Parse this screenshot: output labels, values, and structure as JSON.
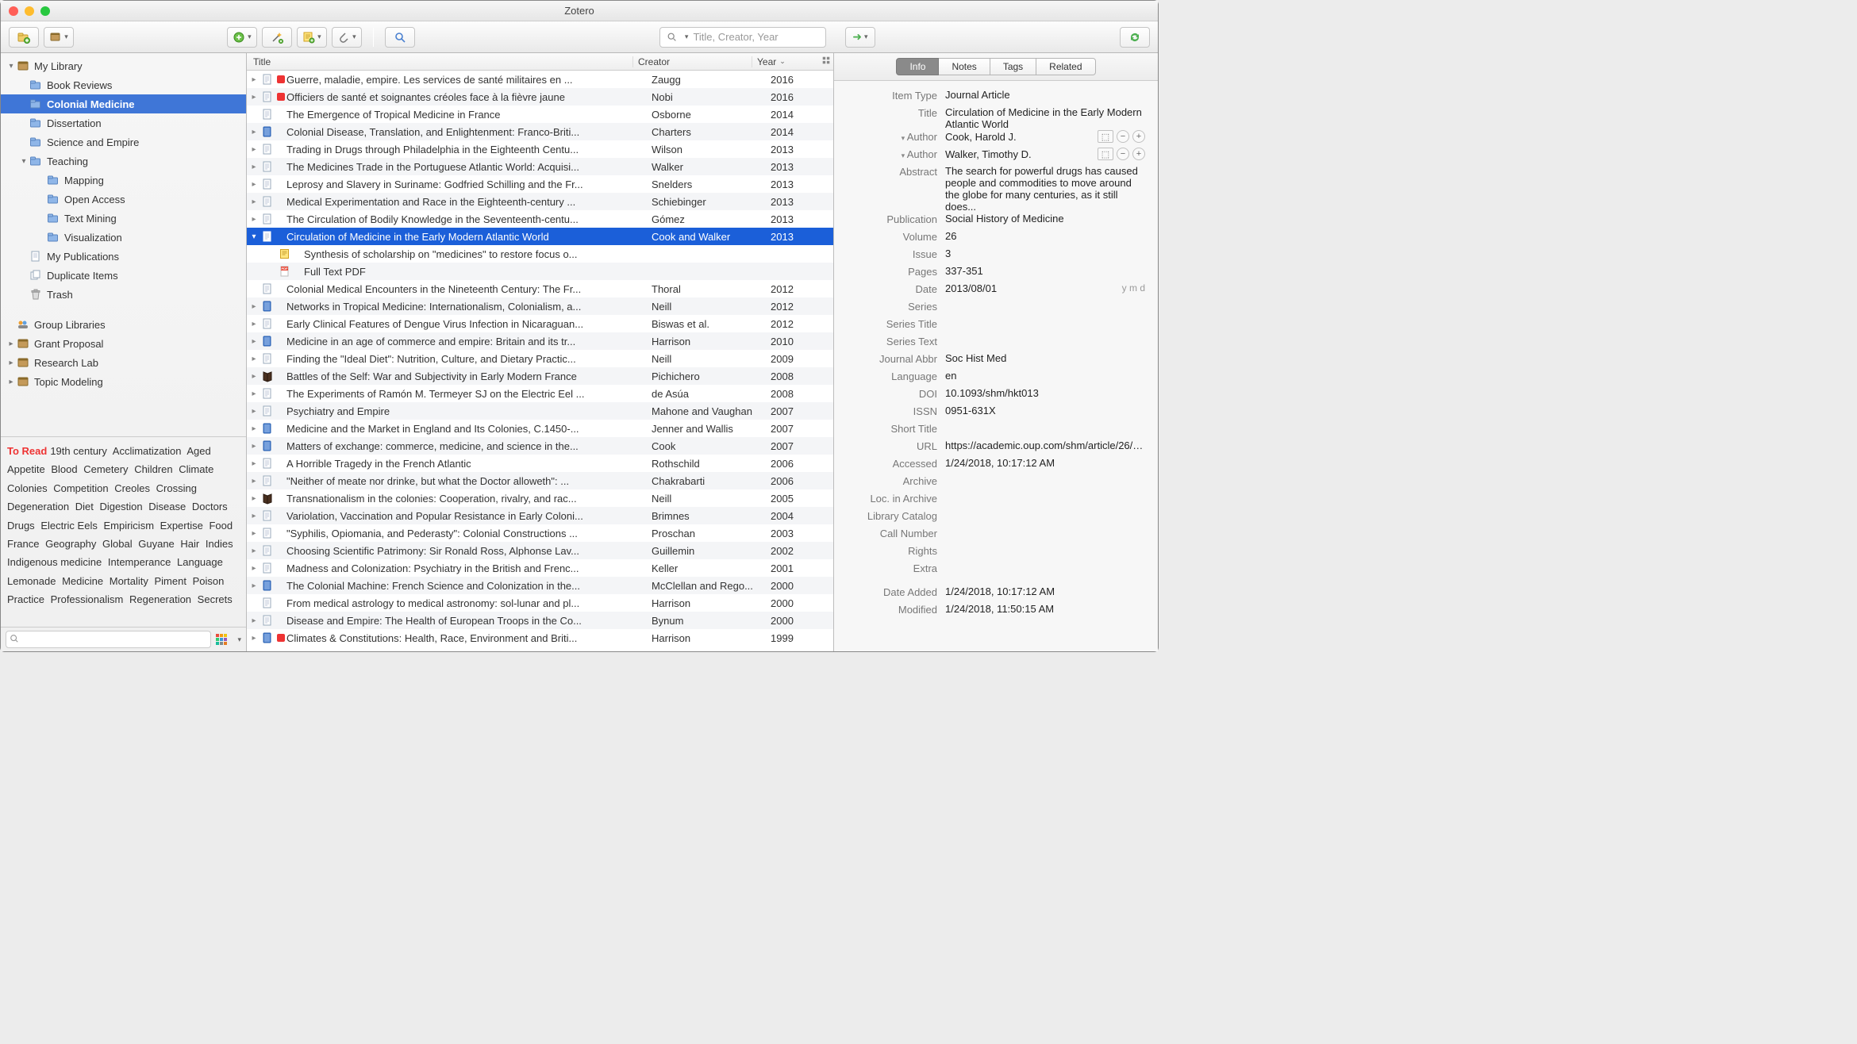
{
  "app": {
    "title": "Zotero"
  },
  "toolbar": {
    "search_placeholder": "Title, Creator, Year"
  },
  "sidebar": {
    "library_label": "My Library",
    "library_items": [
      {
        "label": "Book Reviews",
        "selected": false,
        "disc": "",
        "icon": "folder"
      },
      {
        "label": "Colonial Medicine",
        "selected": true,
        "disc": "",
        "icon": "folder"
      },
      {
        "label": "Dissertation",
        "selected": false,
        "disc": "",
        "icon": "folder"
      },
      {
        "label": "Science and Empire",
        "selected": false,
        "disc": "",
        "icon": "folder"
      },
      {
        "label": "Teaching",
        "selected": false,
        "disc": "down",
        "icon": "folder"
      }
    ],
    "teaching_children": [
      {
        "label": "Mapping"
      },
      {
        "label": "Open Access"
      },
      {
        "label": "Text Mining"
      },
      {
        "label": "Visualization"
      }
    ],
    "special": [
      {
        "label": "My Publications",
        "icon": "pub"
      },
      {
        "label": "Duplicate Items",
        "icon": "dup"
      },
      {
        "label": "Trash",
        "icon": "trash"
      }
    ],
    "group_label": "Group Libraries",
    "groups": [
      {
        "label": "Grant Proposal"
      },
      {
        "label": "Research Lab"
      },
      {
        "label": "Topic Modeling"
      }
    ]
  },
  "tags": {
    "highlight": "To Read",
    "list": [
      "19th century",
      "Acclimatization",
      "Aged",
      "Appetite",
      "Blood",
      "Cemetery",
      "Children",
      "Climate",
      "Colonies",
      "Competition",
      "Creoles",
      "Crossing",
      "Degeneration",
      "Diet",
      "Digestion",
      "Disease",
      "Doctors",
      "Drugs",
      "Electric Eels",
      "Empiricism",
      "Expertise",
      "Food",
      "France",
      "Geography",
      "Global",
      "Guyane",
      "Hair",
      "Indies",
      "Indigenous medicine",
      "Intemperance",
      "Language",
      "Lemonade",
      "Medicine",
      "Mortality",
      "Piment",
      "Poison",
      "Practice",
      "Professionalism",
      "Regeneration",
      "Secrets"
    ]
  },
  "columns": {
    "title": "Title",
    "creator": "Creator",
    "year": "Year"
  },
  "items": [
    {
      "disc": "right",
      "icon": "doc",
      "tag": "#e33",
      "title": "Guerre, maladie, empire. Les services de santé militaires en ...",
      "creator": "Zaugg",
      "year": "2016"
    },
    {
      "disc": "right",
      "icon": "doc",
      "tag": "#e33",
      "title": "Officiers de santé et soignantes créoles face à la fièvre jaune",
      "creator": "Nobi",
      "year": "2016"
    },
    {
      "disc": "",
      "icon": "doc",
      "tag": "",
      "title": "The Emergence of Tropical Medicine in France",
      "creator": "Osborne",
      "year": "2014"
    },
    {
      "disc": "right",
      "icon": "book",
      "tag": "",
      "title": "Colonial Disease, Translation, and Enlightenment: Franco-Briti...",
      "creator": "Charters",
      "year": "2014"
    },
    {
      "disc": "right",
      "icon": "doc",
      "tag": "",
      "title": "Trading in Drugs through Philadelphia in the Eighteenth Centu...",
      "creator": "Wilson",
      "year": "2013"
    },
    {
      "disc": "right",
      "icon": "doc",
      "tag": "",
      "title": "The Medicines Trade in the Portuguese Atlantic World: Acquisi...",
      "creator": "Walker",
      "year": "2013"
    },
    {
      "disc": "right",
      "icon": "doc",
      "tag": "",
      "title": "Leprosy and Slavery in Suriname: Godfried Schilling and the Fr...",
      "creator": "Snelders",
      "year": "2013"
    },
    {
      "disc": "right",
      "icon": "doc",
      "tag": "",
      "title": "Medical Experimentation and Race in the Eighteenth-century ...",
      "creator": "Schiebinger",
      "year": "2013"
    },
    {
      "disc": "right",
      "icon": "doc",
      "tag": "",
      "title": "The Circulation of Bodily Knowledge in the Seventeenth-centu...",
      "creator": "Gómez",
      "year": "2013"
    },
    {
      "disc": "down",
      "icon": "doc",
      "tag": "",
      "title": "Circulation of Medicine in the Early Modern Atlantic World",
      "creator": "Cook and Walker",
      "year": "2013",
      "selected": true
    },
    {
      "disc": "",
      "child": true,
      "icon": "note",
      "tag": "",
      "title": "Synthesis of scholarship on \"medicines\" to restore focus o...",
      "creator": "",
      "year": ""
    },
    {
      "disc": "",
      "child": true,
      "icon": "pdf",
      "tag": "",
      "title": "Full Text PDF",
      "creator": "",
      "year": ""
    },
    {
      "disc": "",
      "icon": "doc",
      "tag": "",
      "title": "Colonial Medical Encounters in the Nineteenth Century: The Fr...",
      "creator": "Thoral",
      "year": "2012"
    },
    {
      "disc": "right",
      "icon": "book",
      "tag": "",
      "title": "Networks in Tropical Medicine: Internationalism, Colonialism, a...",
      "creator": "Neill",
      "year": "2012"
    },
    {
      "disc": "right",
      "icon": "doc",
      "tag": "",
      "title": "Early Clinical Features of Dengue Virus Infection in Nicaraguan...",
      "creator": "Biswas et al.",
      "year": "2012"
    },
    {
      "disc": "right",
      "icon": "book",
      "tag": "",
      "title": "Medicine in an age of commerce and empire: Britain and its tr...",
      "creator": "Harrison",
      "year": "2010"
    },
    {
      "disc": "right",
      "icon": "doc",
      "tag": "",
      "title": "Finding the \"Ideal Diet\": Nutrition, Culture, and Dietary Practic...",
      "creator": "Neill",
      "year": "2009"
    },
    {
      "disc": "right",
      "icon": "bookalt",
      "tag": "",
      "title": "Battles of the Self: War and Subjectivity in Early Modern France",
      "creator": "Pichichero",
      "year": "2008"
    },
    {
      "disc": "right",
      "icon": "doc",
      "tag": "",
      "title": "The Experiments of Ramón M. Termeyer SJ on the Electric Eel ...",
      "creator": "de Asúa",
      "year": "2008"
    },
    {
      "disc": "right",
      "icon": "doc",
      "tag": "",
      "title": "Psychiatry and Empire",
      "creator": "Mahone and Vaughan",
      "year": "2007"
    },
    {
      "disc": "right",
      "icon": "book",
      "tag": "",
      "title": "Medicine and the Market in England and Its Colonies, C.1450-...",
      "creator": "Jenner and Wallis",
      "year": "2007"
    },
    {
      "disc": "right",
      "icon": "book",
      "tag": "",
      "title": "Matters of exchange: commerce, medicine, and science in the...",
      "creator": "Cook",
      "year": "2007"
    },
    {
      "disc": "right",
      "icon": "doc",
      "tag": "",
      "title": "A Horrible Tragedy in the French Atlantic",
      "creator": "Rothschild",
      "year": "2006"
    },
    {
      "disc": "right",
      "icon": "doc",
      "tag": "",
      "title": "\"Neither of meate nor drinke, but what the Doctor alloweth\": ...",
      "creator": "Chakrabarti",
      "year": "2006"
    },
    {
      "disc": "right",
      "icon": "bookalt",
      "tag": "",
      "title": "Transnationalism in the colonies: Cooperation, rivalry, and rac...",
      "creator": "Neill",
      "year": "2005"
    },
    {
      "disc": "right",
      "icon": "doc",
      "tag": "",
      "title": "Variolation, Vaccination and Popular Resistance in Early Coloni...",
      "creator": "Brimnes",
      "year": "2004"
    },
    {
      "disc": "right",
      "icon": "doc",
      "tag": "",
      "title": "\"Syphilis, Opiomania, and Pederasty\": Colonial Constructions ...",
      "creator": "Proschan",
      "year": "2003"
    },
    {
      "disc": "right",
      "icon": "doc",
      "tag": "",
      "title": "Choosing Scientific Patrimony: Sir Ronald Ross, Alphonse Lav...",
      "creator": "Guillemin",
      "year": "2002"
    },
    {
      "disc": "right",
      "icon": "doc",
      "tag": "",
      "title": "Madness and Colonization: Psychiatry in the British and Frenc...",
      "creator": "Keller",
      "year": "2001"
    },
    {
      "disc": "right",
      "icon": "book",
      "tag": "",
      "title": "The Colonial Machine: French Science and Colonization in the...",
      "creator": "McClellan and Rego...",
      "year": "2000"
    },
    {
      "disc": "",
      "icon": "doc",
      "tag": "",
      "title": "From medical astrology to medical astronomy: sol-lunar and pl...",
      "creator": "Harrison",
      "year": "2000"
    },
    {
      "disc": "right",
      "icon": "doc",
      "tag": "",
      "title": "Disease and Empire: The Health of European Troops in the Co...",
      "creator": "Bynum",
      "year": "2000"
    },
    {
      "disc": "right",
      "icon": "book",
      "tag": "#e33",
      "title": "Climates & Constitutions: Health, Race, Environment and Briti...",
      "creator": "Harrison",
      "year": "1999"
    }
  ],
  "info": {
    "tabs": [
      "Info",
      "Notes",
      "Tags",
      "Related"
    ],
    "active_tab": 0,
    "fields": {
      "item_type_label": "Item Type",
      "item_type": "Journal Article",
      "title_label": "Title",
      "title": "Circulation of Medicine in the Early Modern Atlantic World",
      "author_label": "Author",
      "authors": [
        "Cook, Harold J.",
        "Walker, Timothy D."
      ],
      "abstract_label": "Abstract",
      "abstract": "The search for powerful drugs has caused people and commodities to move around the globe for many centuries, as it still does...",
      "publication_label": "Publication",
      "publication": "Social History of Medicine",
      "volume_label": "Volume",
      "volume": "26",
      "issue_label": "Issue",
      "issue": "3",
      "pages_label": "Pages",
      "pages": "337-351",
      "date_label": "Date",
      "date": "2013/08/01",
      "date_hint": "y m d",
      "series_label": "Series",
      "series": "",
      "series_title_label": "Series Title",
      "series_title": "",
      "series_text_label": "Series Text",
      "series_text": "",
      "journal_abbr_label": "Journal Abbr",
      "journal_abbr": "Soc Hist Med",
      "language_label": "Language",
      "language": "en",
      "doi_label": "DOI",
      "doi": "10.1093/shm/hkt013",
      "issn_label": "ISSN",
      "issn": "0951-631X",
      "short_title_label": "Short Title",
      "short_title": "",
      "url_label": "URL",
      "url": "https://academic.oup.com/shm/article/26/3...",
      "accessed_label": "Accessed",
      "accessed": "1/24/2018, 10:17:12 AM",
      "archive_label": "Archive",
      "archive": "",
      "loc_label": "Loc. in Archive",
      "loc": "",
      "catalog_label": "Library Catalog",
      "catalog": "",
      "call_label": "Call Number",
      "call": "",
      "rights_label": "Rights",
      "rights": "",
      "extra_label": "Extra",
      "extra": "",
      "added_label": "Date Added",
      "added": "1/24/2018, 10:17:12 AM",
      "modified_label": "Modified",
      "modified": "1/24/2018, 11:50:15 AM"
    }
  }
}
